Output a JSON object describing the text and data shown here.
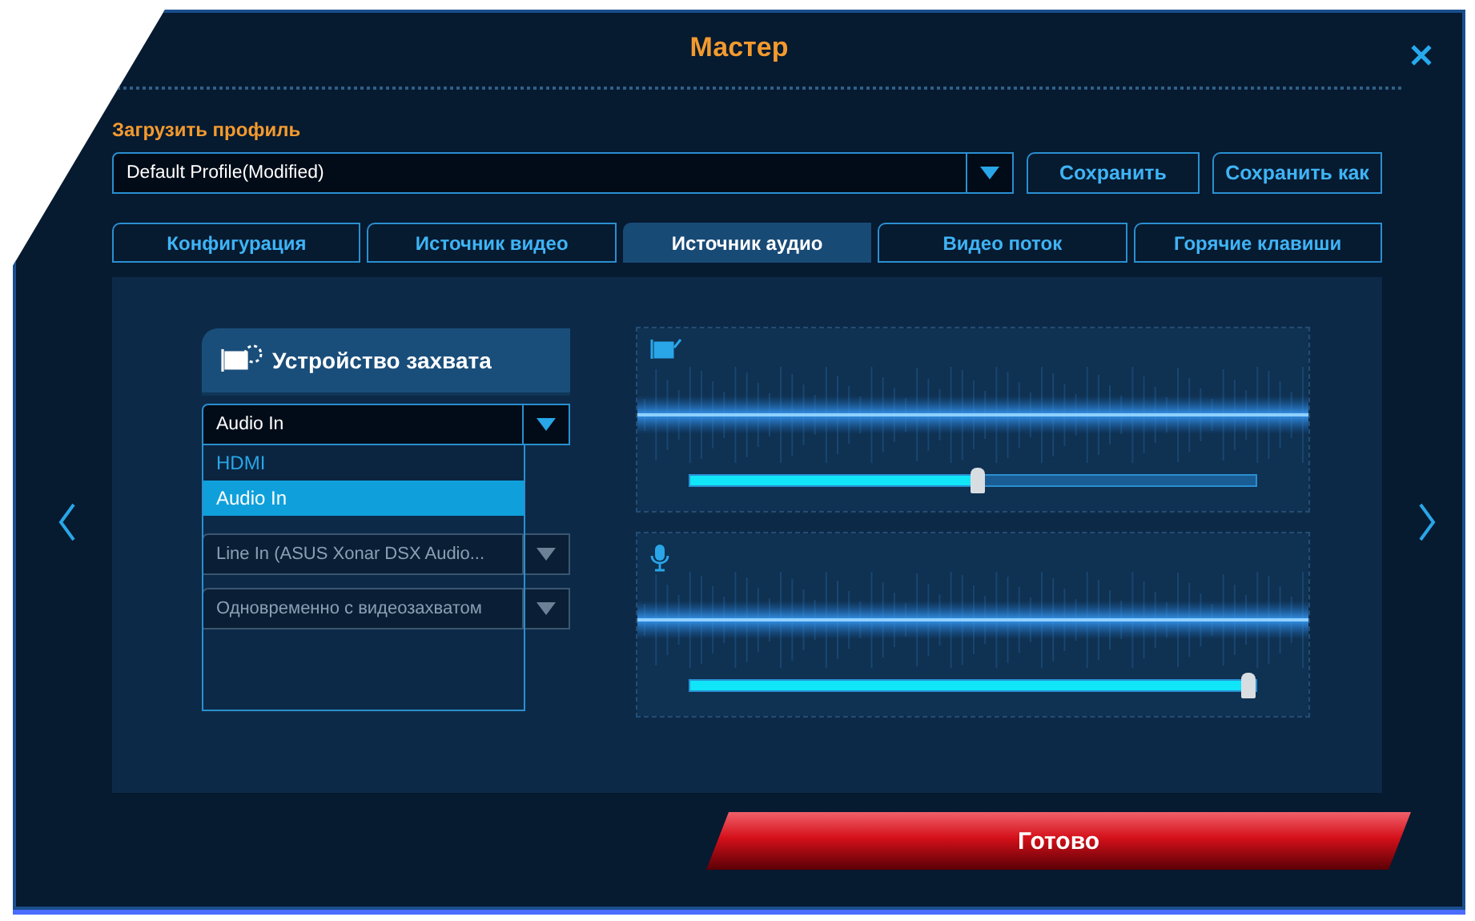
{
  "window": {
    "title": "Мастер"
  },
  "profile": {
    "label": "Загрузить профиль",
    "value": "Default Profile(Modified)",
    "buttons": [
      "Сохранить",
      "Сохранить как"
    ]
  },
  "tabs": [
    {
      "label": "Конфигурация",
      "selected": false
    },
    {
      "label": "Источник видео",
      "selected": false
    },
    {
      "label": "Источник аудио",
      "selected": true
    },
    {
      "label": "Видео поток",
      "selected": false
    },
    {
      "label": "Горячие клавиши",
      "selected": false
    }
  ],
  "capture_device": {
    "title": "Устройство захвата",
    "value": "Audio In",
    "options": [
      {
        "label": "HDMI",
        "selected": false
      },
      {
        "label": "Audio In",
        "selected": true
      }
    ]
  },
  "dimmed_dropdowns": [
    {
      "value": "Line In (ASUS Xonar DSX Audio..."
    },
    {
      "value": "Одновременно с видеозахватом"
    }
  ],
  "audio_channels": [
    {
      "kind": "capture",
      "level": 0.51
    },
    {
      "kind": "microphone",
      "level": 0.99
    }
  ],
  "done_button": "Готово"
}
